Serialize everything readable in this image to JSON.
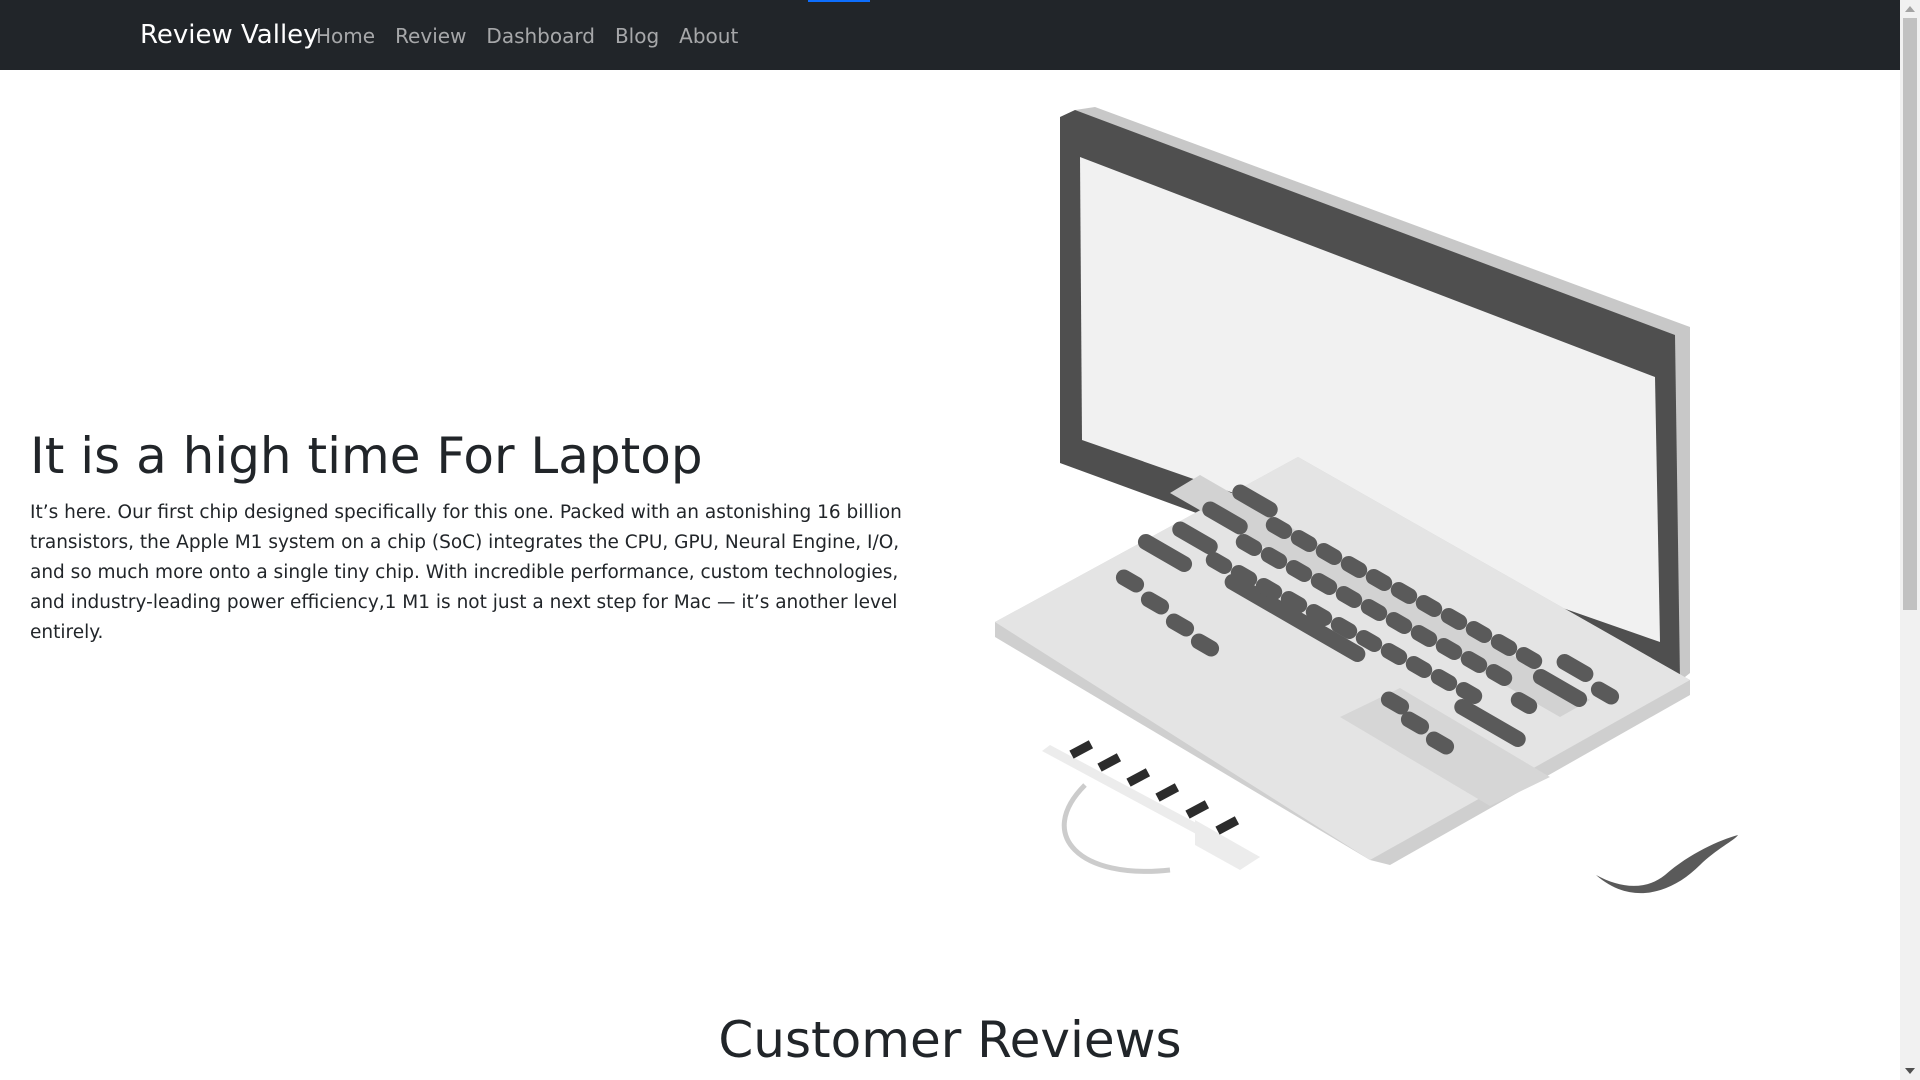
{
  "navbar": {
    "brand": "Review Valley",
    "links": [
      "Home",
      "Review",
      "Dashboard",
      "Blog",
      "About"
    ]
  },
  "hero": {
    "title": "It is a high time For Laptop",
    "text": "It’s here. Our first chip designed specifically for this one. Packed with an astonishing 16 billion transistors, the Apple M1 system on a chip (SoC) integrates the CPU, GPU, Neural Engine, I/O, and so much more onto a single tiny chip. With incredible performance, custom technologies, and industry-leading power efficiency,1 M1 is not just a next step for Mac — it’s another level entirely."
  },
  "reviews": {
    "title": "Customer Reviews"
  },
  "colors": {
    "navbar_bg": "#212529",
    "accent": "#0d6efd"
  },
  "icons": {
    "laptop": "laptop-illustration-icon"
  }
}
